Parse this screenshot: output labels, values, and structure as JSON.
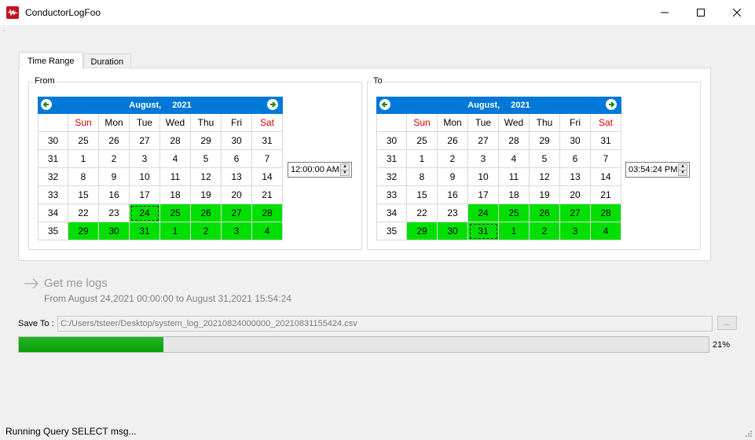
{
  "window": {
    "title": "ConductorLogFoo"
  },
  "tabs": [
    {
      "label": "Time Range",
      "active": true
    },
    {
      "label": "Duration",
      "active": false
    }
  ],
  "from": {
    "legend": "From",
    "month_label": "August",
    "year_label": "2021",
    "time": "12:00:00 AM",
    "dow": [
      "Sun",
      "Mon",
      "Tue",
      "Wed",
      "Thu",
      "Fri",
      "Sat"
    ],
    "rows": [
      {
        "week": "30",
        "days": [
          "25",
          "26",
          "27",
          "28",
          "29",
          "30",
          "31"
        ],
        "sel": [
          0,
          0,
          0,
          0,
          0,
          0,
          0
        ]
      },
      {
        "week": "31",
        "days": [
          "1",
          "2",
          "3",
          "4",
          "5",
          "6",
          "7"
        ],
        "sel": [
          0,
          0,
          0,
          0,
          0,
          0,
          0
        ]
      },
      {
        "week": "32",
        "days": [
          "8",
          "9",
          "10",
          "11",
          "12",
          "13",
          "14"
        ],
        "sel": [
          0,
          0,
          0,
          0,
          0,
          0,
          0
        ]
      },
      {
        "week": "33",
        "days": [
          "15",
          "16",
          "17",
          "18",
          "19",
          "20",
          "21"
        ],
        "sel": [
          0,
          0,
          0,
          0,
          0,
          0,
          0
        ]
      },
      {
        "week": "34",
        "days": [
          "22",
          "23",
          "24",
          "25",
          "26",
          "27",
          "28"
        ],
        "sel": [
          0,
          0,
          1,
          1,
          1,
          1,
          1
        ]
      },
      {
        "week": "35",
        "days": [
          "29",
          "30",
          "31",
          "1",
          "2",
          "3",
          "4"
        ],
        "sel": [
          1,
          1,
          1,
          1,
          1,
          1,
          1
        ]
      }
    ],
    "focus": [
      4,
      2
    ]
  },
  "to": {
    "legend": "To",
    "month_label": "August",
    "year_label": "2021",
    "time": "03:54:24 PM",
    "dow": [
      "Sun",
      "Mon",
      "Tue",
      "Wed",
      "Thu",
      "Fri",
      "Sat"
    ],
    "rows": [
      {
        "week": "30",
        "days": [
          "25",
          "26",
          "27",
          "28",
          "29",
          "30",
          "31"
        ],
        "sel": [
          0,
          0,
          0,
          0,
          0,
          0,
          0
        ]
      },
      {
        "week": "31",
        "days": [
          "1",
          "2",
          "3",
          "4",
          "5",
          "6",
          "7"
        ],
        "sel": [
          0,
          0,
          0,
          0,
          0,
          0,
          0
        ]
      },
      {
        "week": "32",
        "days": [
          "8",
          "9",
          "10",
          "11",
          "12",
          "13",
          "14"
        ],
        "sel": [
          0,
          0,
          0,
          0,
          0,
          0,
          0
        ]
      },
      {
        "week": "33",
        "days": [
          "15",
          "16",
          "17",
          "18",
          "19",
          "20",
          "21"
        ],
        "sel": [
          0,
          0,
          0,
          0,
          0,
          0,
          0
        ]
      },
      {
        "week": "34",
        "days": [
          "22",
          "23",
          "24",
          "25",
          "26",
          "27",
          "28"
        ],
        "sel": [
          0,
          0,
          1,
          1,
          1,
          1,
          1
        ]
      },
      {
        "week": "35",
        "days": [
          "29",
          "30",
          "31",
          "1",
          "2",
          "3",
          "4"
        ],
        "sel": [
          1,
          1,
          1,
          1,
          1,
          1,
          1
        ]
      }
    ],
    "focus": [
      5,
      2
    ]
  },
  "actions": {
    "get_logs_label": "Get me logs",
    "range_text": "From August 24,2021 00:00:00 to August 31,2021 15:54:24"
  },
  "save": {
    "label": "Save To :",
    "path": "C:/Users/tsteer/Desktop/system_log_20210824000000_20210831155424.csv",
    "browse_label": "..."
  },
  "progress": {
    "value": 0.21,
    "text": "21%"
  },
  "status": {
    "message": "Running Query SELECT msg..."
  },
  "colors": {
    "calendar_header": "#0078d7",
    "selected_day": "#00e000",
    "weekend_header": "#d00000",
    "progress_fill": "#06a006"
  }
}
